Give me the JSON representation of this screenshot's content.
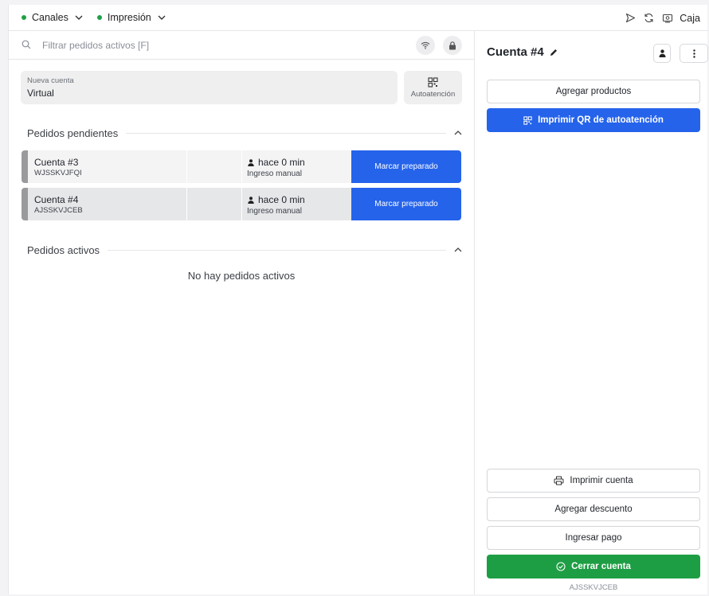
{
  "topbar": {
    "channels": [
      {
        "label": "Canales",
        "status_color": "#1fa045"
      },
      {
        "label": "Impresión",
        "status_color": "#1fa045"
      }
    ],
    "icons": [
      "send-icon",
      "refresh-icon",
      "cash-register-icon"
    ],
    "caja_label": "Caja"
  },
  "search": {
    "placeholder": "Filtrar pedidos activos [F]",
    "value": ""
  },
  "new_account": {
    "label": "Nueva cuenta",
    "value": "Virtual",
    "self_service_label": "Autoatención"
  },
  "pending": {
    "title": "Pedidos pendientes",
    "orders": [
      {
        "name": "Cuenta #3",
        "code": "WJSSKVJFQI",
        "time": "hace 0 min",
        "origin": "Ingreso manual",
        "action": "Marcar preparado",
        "selected": false
      },
      {
        "name": "Cuenta #4",
        "code": "AJSSKVJCEB",
        "time": "hace 0 min",
        "origin": "Ingreso manual",
        "action": "Marcar preparado",
        "selected": true
      }
    ]
  },
  "active": {
    "title": "Pedidos activos",
    "empty_text": "No hay pedidos activos"
  },
  "account": {
    "title": "Cuenta #4",
    "add_products_label": "Agregar productos",
    "print_qr_label": "Imprimir QR de autoatención",
    "print_account_label": "Imprimir cuenta",
    "add_discount_label": "Agregar descuento",
    "payment_label": "Ingresar pago",
    "close_label": "Cerrar cuenta",
    "code": "AJSSKVJCEB"
  },
  "colors": {
    "accent_blue": "#2563eb",
    "success_green": "#1e9e44",
    "status_dot": "#1fa045"
  }
}
